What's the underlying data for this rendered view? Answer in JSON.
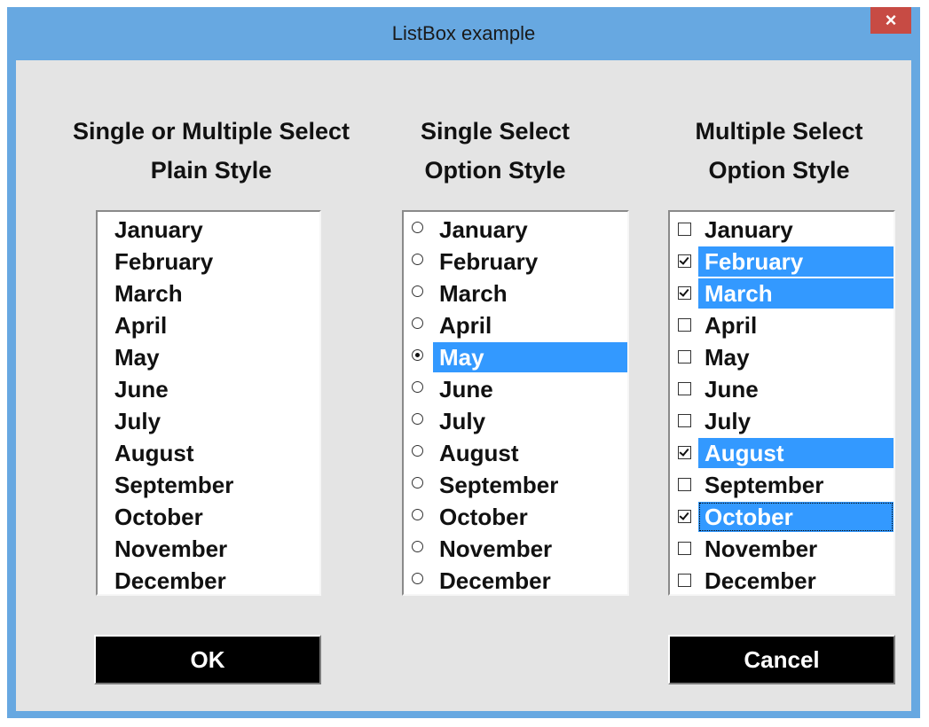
{
  "window": {
    "title": "ListBox example",
    "close_label": "×"
  },
  "columns": [
    {
      "heading_line1": "Single or Multiple Select",
      "heading_line2": "Plain Style",
      "style": "plain",
      "items": [
        {
          "label": "January",
          "selected": false
        },
        {
          "label": "February",
          "selected": false
        },
        {
          "label": "March",
          "selected": false
        },
        {
          "label": "April",
          "selected": false
        },
        {
          "label": "May",
          "selected": false
        },
        {
          "label": "June",
          "selected": false
        },
        {
          "label": "July",
          "selected": false
        },
        {
          "label": "August",
          "selected": false
        },
        {
          "label": "September",
          "selected": false
        },
        {
          "label": "October",
          "selected": false
        },
        {
          "label": "November",
          "selected": false
        },
        {
          "label": "December",
          "selected": false
        }
      ]
    },
    {
      "heading_line1": "Single Select",
      "heading_line2": "Option Style",
      "style": "radio",
      "items": [
        {
          "label": "January",
          "selected": false
        },
        {
          "label": "February",
          "selected": false
        },
        {
          "label": "March",
          "selected": false
        },
        {
          "label": "April",
          "selected": false
        },
        {
          "label": "May",
          "selected": true
        },
        {
          "label": "June",
          "selected": false
        },
        {
          "label": "July",
          "selected": false
        },
        {
          "label": "August",
          "selected": false
        },
        {
          "label": "September",
          "selected": false
        },
        {
          "label": "October",
          "selected": false
        },
        {
          "label": "November",
          "selected": false
        },
        {
          "label": "December",
          "selected": false
        }
      ]
    },
    {
      "heading_line1": "Multiple Select",
      "heading_line2": "Option Style",
      "style": "checkbox",
      "items": [
        {
          "label": "January",
          "selected": false
        },
        {
          "label": "February",
          "selected": true
        },
        {
          "label": "March",
          "selected": true
        },
        {
          "label": "April",
          "selected": false
        },
        {
          "label": "May",
          "selected": false
        },
        {
          "label": "June",
          "selected": false
        },
        {
          "label": "July",
          "selected": false
        },
        {
          "label": "August",
          "selected": true
        },
        {
          "label": "September",
          "selected": false
        },
        {
          "label": "October",
          "selected": true,
          "focused": true
        },
        {
          "label": "November",
          "selected": false
        },
        {
          "label": "December",
          "selected": false
        }
      ]
    }
  ],
  "buttons": {
    "ok_label": "OK",
    "cancel_label": "Cancel"
  },
  "colors": {
    "frame": "#67a8e1",
    "close": "#c74b44",
    "client": "#e4e4e4",
    "selection": "#3399ff"
  }
}
